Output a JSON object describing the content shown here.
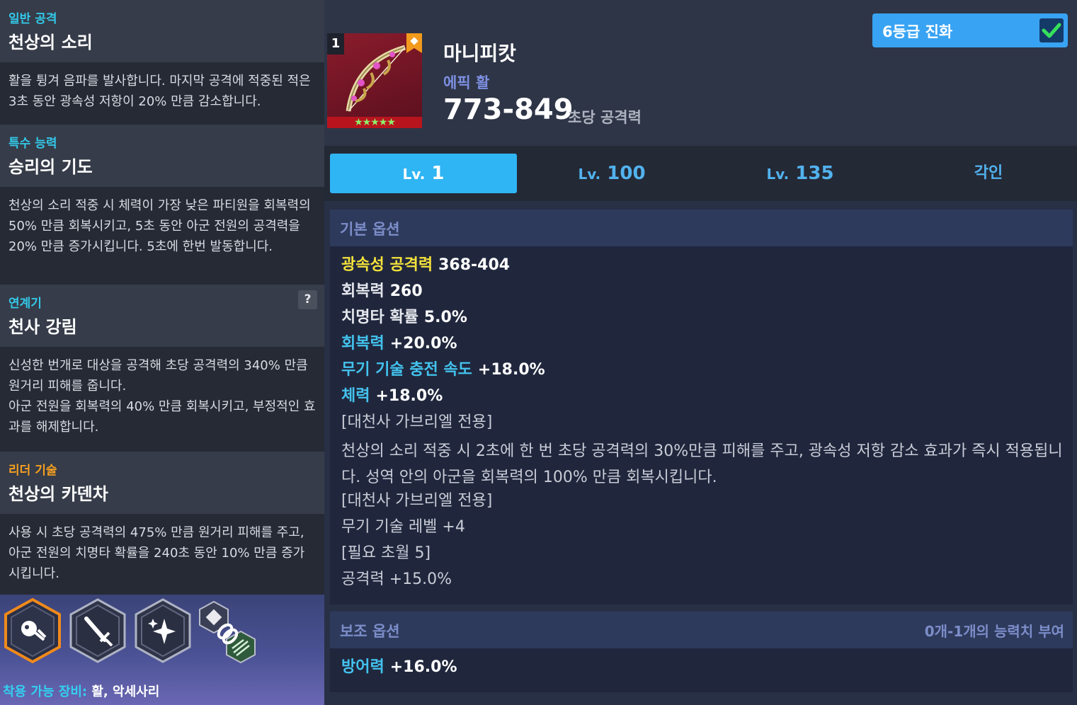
{
  "skills": [
    {
      "type": "일반 공격",
      "name": "천상의 소리",
      "desc": "활을 튕겨 음파를 발사합니다. 마지막 공격에 적중된 적은 3초 동안 광속성 저항이 20% 만큼 감소합니다."
    },
    {
      "type": "특수 능력",
      "name": "승리의 기도",
      "desc": "천상의 소리 적중 시 체력이 가장 낮은 파티원을 회복력의 50% 만큼 회복시키고, 5초 동안 아군 전원의 공격력을 20% 만큼 증가시킵니다. 5초에 한번 발동합니다."
    },
    {
      "type": "연계기",
      "name": "천사 강림",
      "help": "?",
      "desc": "신성한 번개로 대상을 공격해 초당 공격력의 340% 만큼 원거리 피해를 줍니다.\n아군 전원을 회복력의 40% 만큼 회복시키고, 부정적인 효과를 해제합니다."
    },
    {
      "type": "리더 기술",
      "name": "천상의 카덴차",
      "desc": "사용 시 초당 공격력의 475% 만큼 원거리 피해를 주고, 아군 전원의 치명타 확률을 240초 동안 10% 만큼 증가시킵니다."
    }
  ],
  "equip": {
    "label": "착용 가능 장비:",
    "value": "활, 악세사리",
    "icons": [
      "bow-skill-icon",
      "sword-skill-icon",
      "sparkle-skill-icon",
      "chain-link-icon"
    ]
  },
  "weapon": {
    "slot_number": "1",
    "stars": "★★★★★",
    "name": "마니피캇",
    "grade": "에픽 활",
    "attack": "773-849",
    "attack_label": "초당 공격력"
  },
  "evolve": {
    "label": "6등급 진화",
    "checked": true
  },
  "tabs": [
    {
      "prefix": "Lv.",
      "value": "1"
    },
    {
      "prefix": "Lv.",
      "value": "100"
    },
    {
      "prefix": "Lv.",
      "value": "135"
    },
    {
      "prefix": "",
      "value": "각인"
    }
  ],
  "basic": {
    "title": "기본 옵션",
    "stats": [
      {
        "key": "광속성 공격력",
        "val": "368-404"
      },
      {
        "key": "회복력",
        "val": "260"
      },
      {
        "key": "치명타 확률",
        "val": "5.0%"
      },
      {
        "key": "회복력",
        "val": "+20.0%"
      },
      {
        "key": "무기 기술 충전 속도",
        "val": "+18.0%"
      },
      {
        "key": "체력",
        "val": "+18.0%"
      }
    ],
    "extra": [
      "[대천사 가브리엘 전용]",
      "천상의 소리 적중 시 2초에 한 번 초당 공격력의 30%만큼 피해를 주고, 광속성 저항 감소 효과가 즉시 적용됩니다. 성역 안의 아군을 회복력의 100% 만큼 회복시킵니다.",
      "[대천사 가브리엘 전용]",
      "무기 기술 레벨 +4",
      "[필요 초월 5]",
      "공격력 +15.0%"
    ]
  },
  "sub": {
    "title": "보조 옵션",
    "note": "0개-1개의 능력치 부여",
    "stats": [
      {
        "key": "방어력",
        "val": "+16.0%"
      }
    ]
  },
  "colors": {
    "accent_blue": "#2fb5f3",
    "stat_yellow": "#f4e23b",
    "stat_blue": "#43c3ee",
    "leader_orange": "#f5a020"
  }
}
